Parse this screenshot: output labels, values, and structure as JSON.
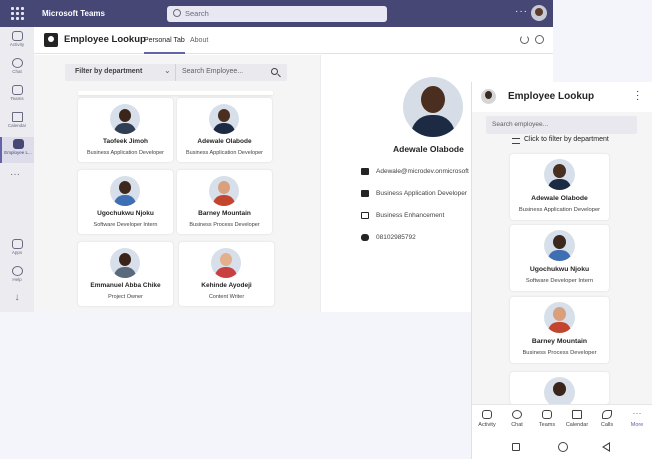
{
  "titlebar": {
    "app_name": "Microsoft Teams",
    "search_placeholder": "Search",
    "more": "···"
  },
  "rail": [
    {
      "label": "Activity",
      "icon": "bell-icon"
    },
    {
      "label": "Chat",
      "icon": "chat-icon"
    },
    {
      "label": "Teams",
      "icon": "teams-icon"
    },
    {
      "label": "Calendar",
      "icon": "calendar-icon"
    },
    {
      "label": "Employee L...",
      "icon": "employee-lookup-icon",
      "active": true
    },
    {
      "label": "Apps",
      "icon": "apps-icon"
    },
    {
      "label": "Help",
      "icon": "help-icon"
    }
  ],
  "rail_more": "···",
  "app": {
    "title": "Employee Lookup",
    "tabs": [
      "Personal Tab",
      "About"
    ],
    "filter": {
      "label": "Filter by department",
      "chevron": "⌄",
      "search_placeholder": "Search Employee..."
    }
  },
  "employees": [
    {
      "name": "Taofeek Jimoh",
      "role": "Business Application Developer",
      "skin": "#3b2419",
      "shirt": "#2f3d55"
    },
    {
      "name": "Adewale Olabode",
      "role": "Business Application Developer",
      "skin": "#4a2e20",
      "shirt": "#1d2a44"
    },
    {
      "name": "Ugochukwu Njoku",
      "role": "Software Developer Intern",
      "skin": "#3e271c",
      "shirt": "#3e6fb3"
    },
    {
      "name": "Barney Mountain",
      "role": "Business Process Developer",
      "skin": "#d9a07e",
      "shirt": "#c3452f"
    },
    {
      "name": "Emmanuel Abba Chike",
      "role": "Project Owner",
      "skin": "#3a2419",
      "shirt": "#596a7c"
    },
    {
      "name": "Kehinde Ayodeji",
      "role": "Content Writer",
      "skin": "#e2b08d",
      "shirt": "#c94040"
    }
  ],
  "detail": {
    "name": "Adewale Olabode",
    "email": "Adewale@microdev.onmicrosoft",
    "role": "Business Application Developer",
    "department": "Business Enhancement",
    "phone": "08102985792"
  },
  "mobile": {
    "title": "Employee Lookup",
    "search_placeholder": "Search employee...",
    "filter_label": "Click to filter by department",
    "cards": [
      {
        "name": "Adewale Olabode",
        "role": "Business Application Developer",
        "skin": "#4a2e20",
        "shirt": "#1d2a44"
      },
      {
        "name": "Ugochukwu Njoku",
        "role": "Software Developer Intern",
        "skin": "#3e271c",
        "shirt": "#3e6fb3"
      },
      {
        "name": "Barney Mountain",
        "role": "Business Process Developer",
        "skin": "#d9a07e",
        "shirt": "#c3452f"
      }
    ],
    "nav": [
      "Activity",
      "Chat",
      "Teams",
      "Calendar",
      "Calls",
      "More"
    ]
  },
  "colors": {
    "teams_purple": "#464775",
    "accent": "#6264a7"
  }
}
